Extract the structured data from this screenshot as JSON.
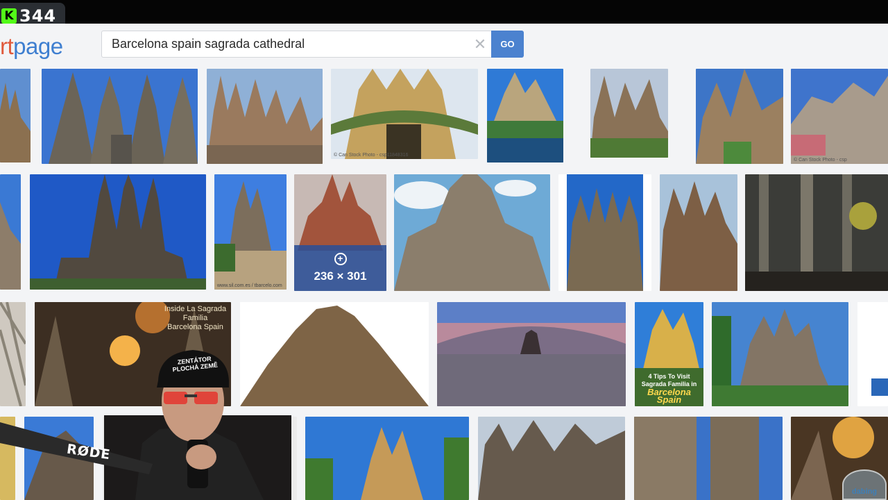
{
  "stream": {
    "platform_letter": "K",
    "viewer_count": "344"
  },
  "site": {
    "logo_part1": "rt",
    "logo_part2": "page"
  },
  "search": {
    "query": "Barcelona spain sagrada cathedral",
    "clear_glyph": "✕",
    "go_label": "GO"
  },
  "results": {
    "hover": {
      "plus_glyph": "+",
      "dimensions": "236 × 301"
    },
    "captions": {
      "canstock1": "© Can Stock Photo - csp11848316",
      "canstock2": "© Can Stock Photo - csp",
      "small_caption": "www.sil.com.es / tbarcelo.com"
    },
    "overlay_inside_line1": "Inside La Sagrada Familia",
    "overlay_inside_line2": "Barcelona Spain",
    "overlay_tips_line1": "4 Tips To Visit",
    "overlay_tips_line2": "Sagrada Familia in",
    "overlay_tips_city": "Barcelona Spain"
  },
  "webcam": {
    "mic_brand": "RØDE",
    "cap_line1": "ZENTÁTOR",
    "cap_line2": "PLOCHÁ ZEMĚ"
  },
  "watermark": "dabing",
  "colors": {
    "go_button": "#4b82cf",
    "logo_orange": "#e05a3c",
    "logo_blue": "#3f7fd0",
    "hover_overlay": "#2b4e96",
    "kick_green": "#53fc18"
  }
}
